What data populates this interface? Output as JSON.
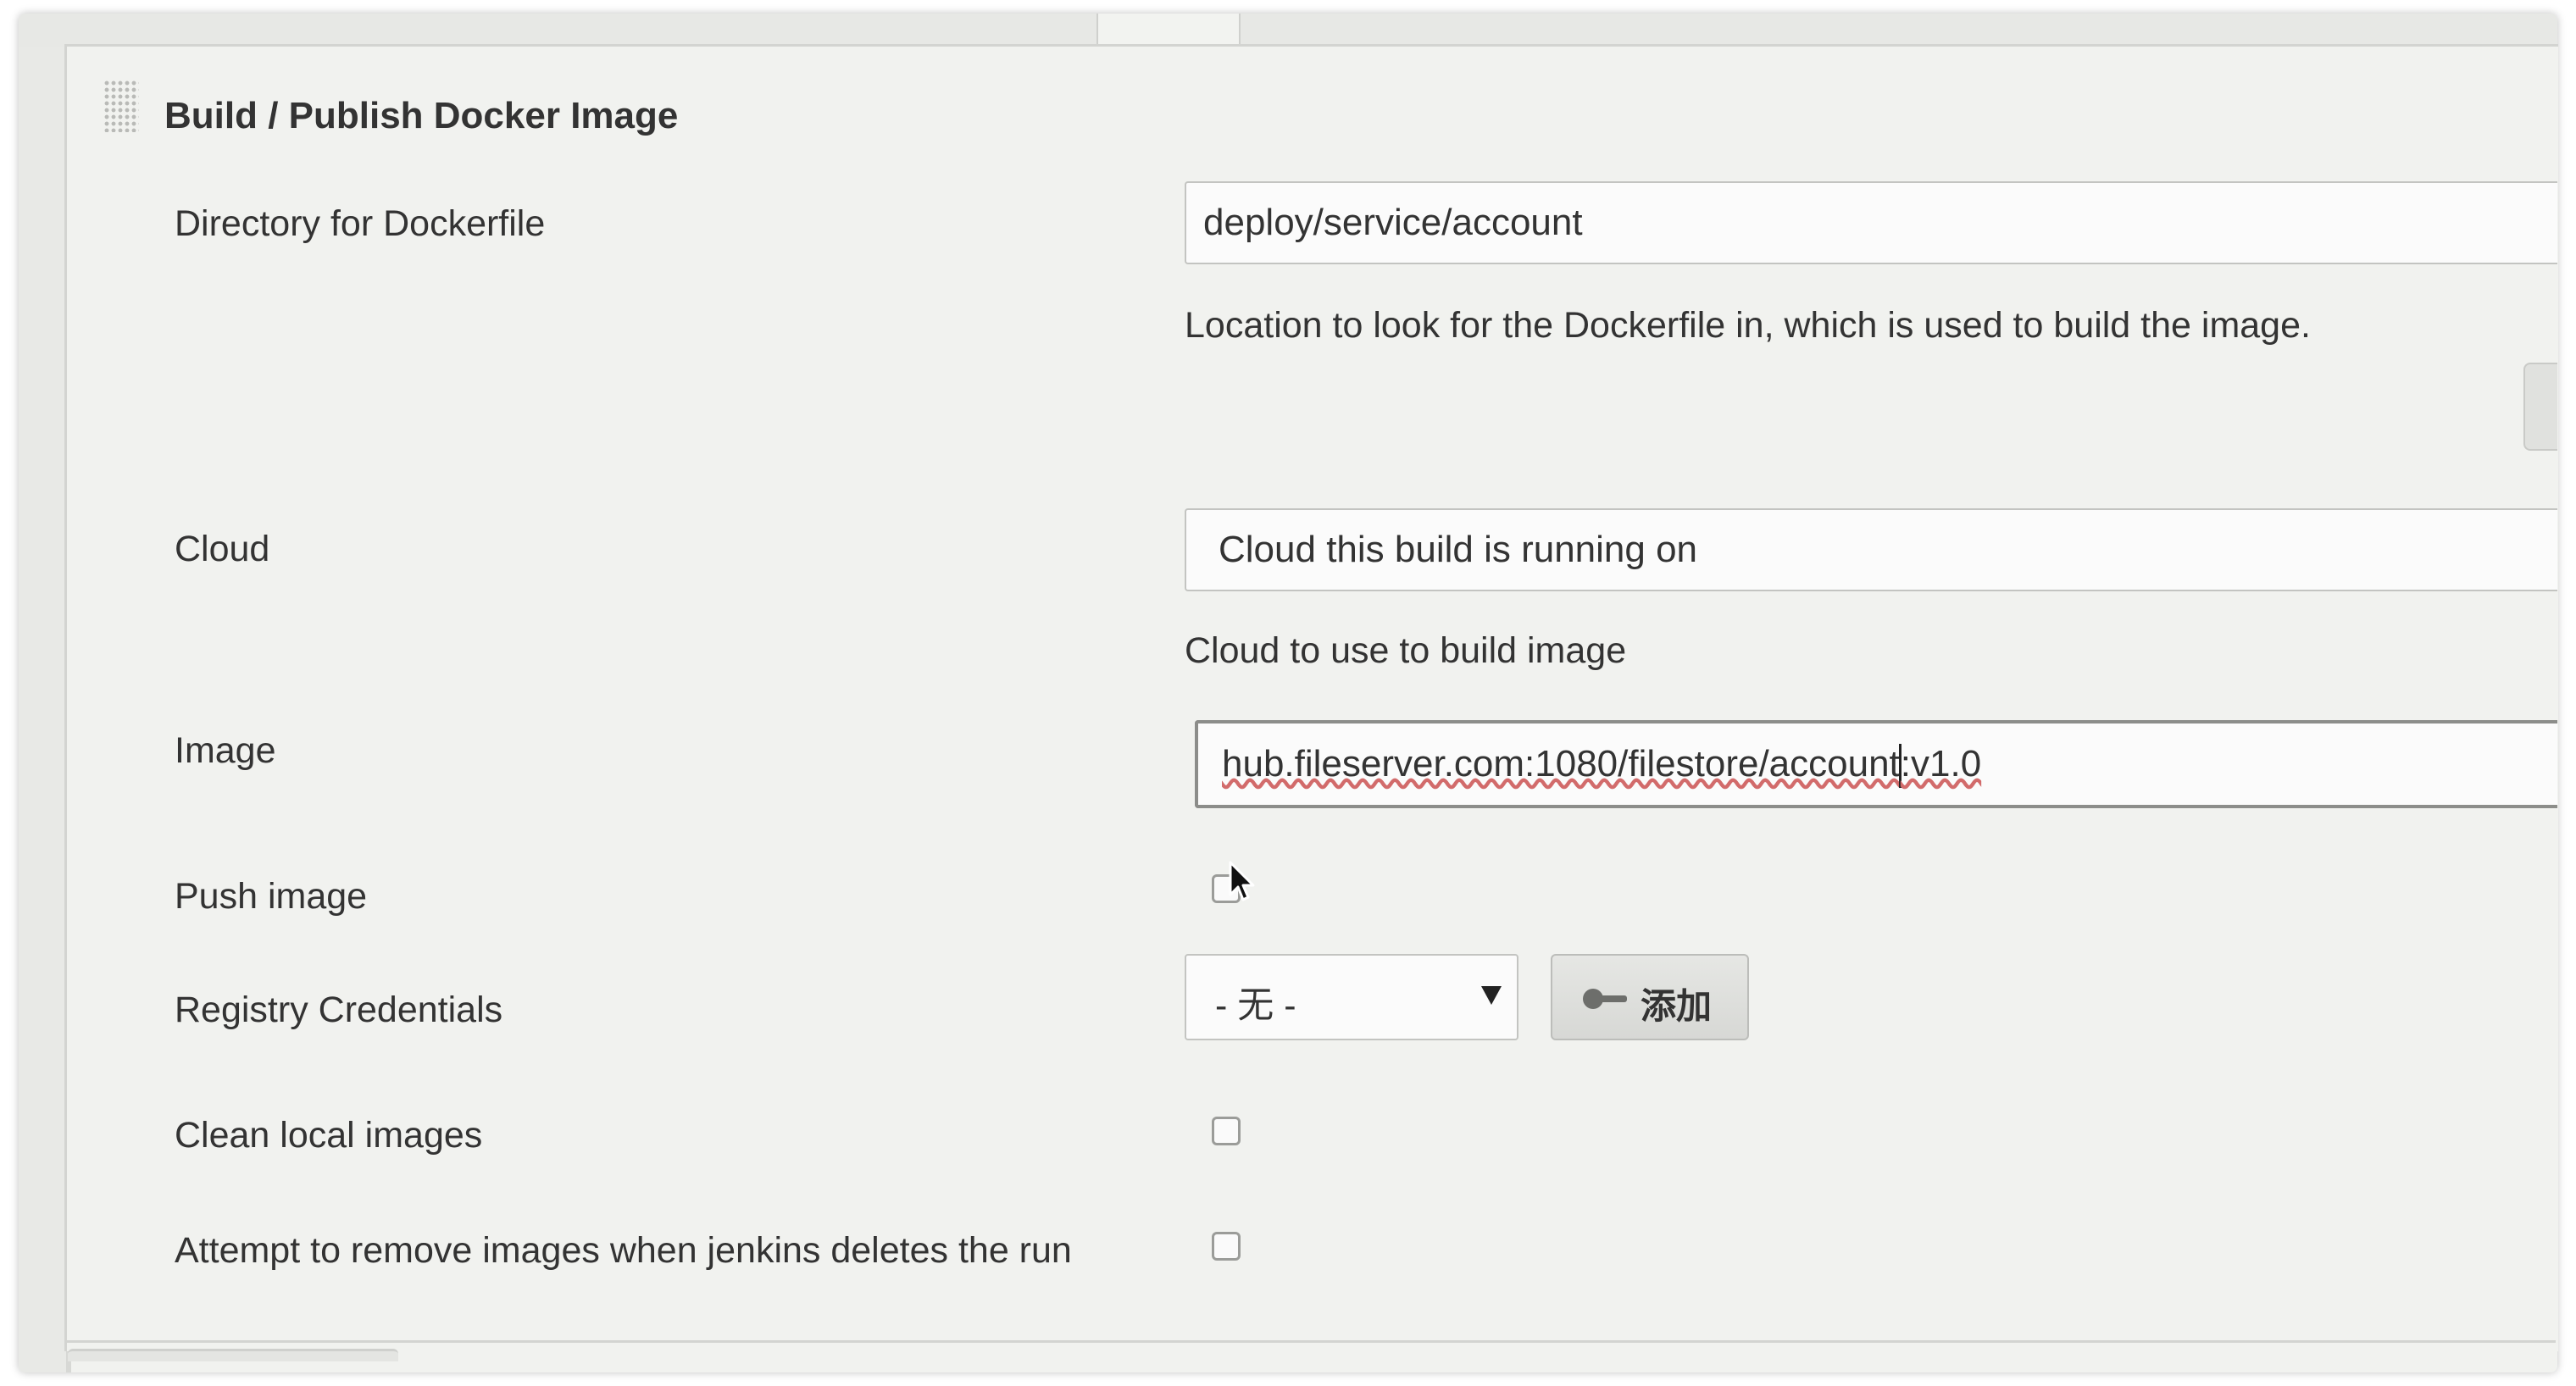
{
  "section": {
    "title": "Build / Publish Docker Image"
  },
  "dockerfile": {
    "label": "Directory for Dockerfile",
    "value": "deploy/service/account",
    "help": "Location to look for the Dockerfile in, which is used to build the image."
  },
  "cloud": {
    "label": "Cloud",
    "value": "Cloud this build is running on",
    "help": "Cloud to use to build image"
  },
  "image": {
    "label": "Image",
    "value_before_caret": "hub.fileserver.com:1080/filestore/account",
    "value_after_caret": ":v1.0"
  },
  "push_image": {
    "label": "Push image",
    "checked": false
  },
  "registry_credentials": {
    "label": "Registry Credentials",
    "selected": "- 无 -",
    "add_button_label": "添加"
  },
  "clean_local_images": {
    "label": "Clean local images",
    "checked": false
  },
  "remove_images": {
    "label": "Attempt to remove images when jenkins deletes the run",
    "checked": false
  }
}
